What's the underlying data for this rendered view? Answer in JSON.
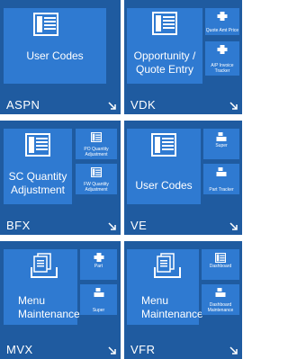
{
  "groups": [
    {
      "name": "ASPN",
      "main_tile": {
        "label": "User Codes",
        "icon": "list-view-icon"
      },
      "side_tiles": []
    },
    {
      "name": "VDK",
      "main_tile": {
        "label": "Opportunity / Quote Entry",
        "icon": "list-view-icon"
      },
      "side_tiles": [
        {
          "label": "Quote Amt Price",
          "icon": "printer-icon"
        },
        {
          "label": "A/P Invoice Tracker",
          "icon": "printer-icon"
        }
      ]
    },
    {
      "name": "BFX",
      "main_tile": {
        "label": "SC Quantity Adjustment",
        "icon": "list-view-icon"
      },
      "side_tiles": [
        {
          "label": "PO Quantity Adjustment",
          "icon": "list-view-icon"
        },
        {
          "label": "FW Quantity Adjustment",
          "icon": "list-view-icon"
        }
      ]
    },
    {
      "name": "VE",
      "main_tile": {
        "label": "User Codes",
        "icon": "list-view-icon"
      },
      "side_tiles": [
        {
          "label": "Super",
          "icon": "tray-icon"
        },
        {
          "label": "Part Tracker",
          "icon": "tray-icon"
        }
      ]
    },
    {
      "name": "MVX",
      "main_tile": {
        "label": "Menu Maintenance",
        "icon": "menu-documents-icon"
      },
      "side_tiles": [
        {
          "label": "Part",
          "icon": "printer-icon"
        },
        {
          "label": "Super",
          "icon": "tray-icon"
        }
      ]
    },
    {
      "name": "VFR",
      "main_tile": {
        "label": "Menu Maintenance",
        "icon": "menu-documents-icon"
      },
      "side_tiles": [
        {
          "label": "Dashboard",
          "icon": "list-view-icon"
        },
        {
          "label": "Dashboard Maintenance",
          "icon": "tray-icon"
        }
      ]
    }
  ],
  "colors": {
    "group_bg": "#1f5ba0",
    "tile_bg": "#2f7ad1",
    "text": "#ffffff"
  }
}
